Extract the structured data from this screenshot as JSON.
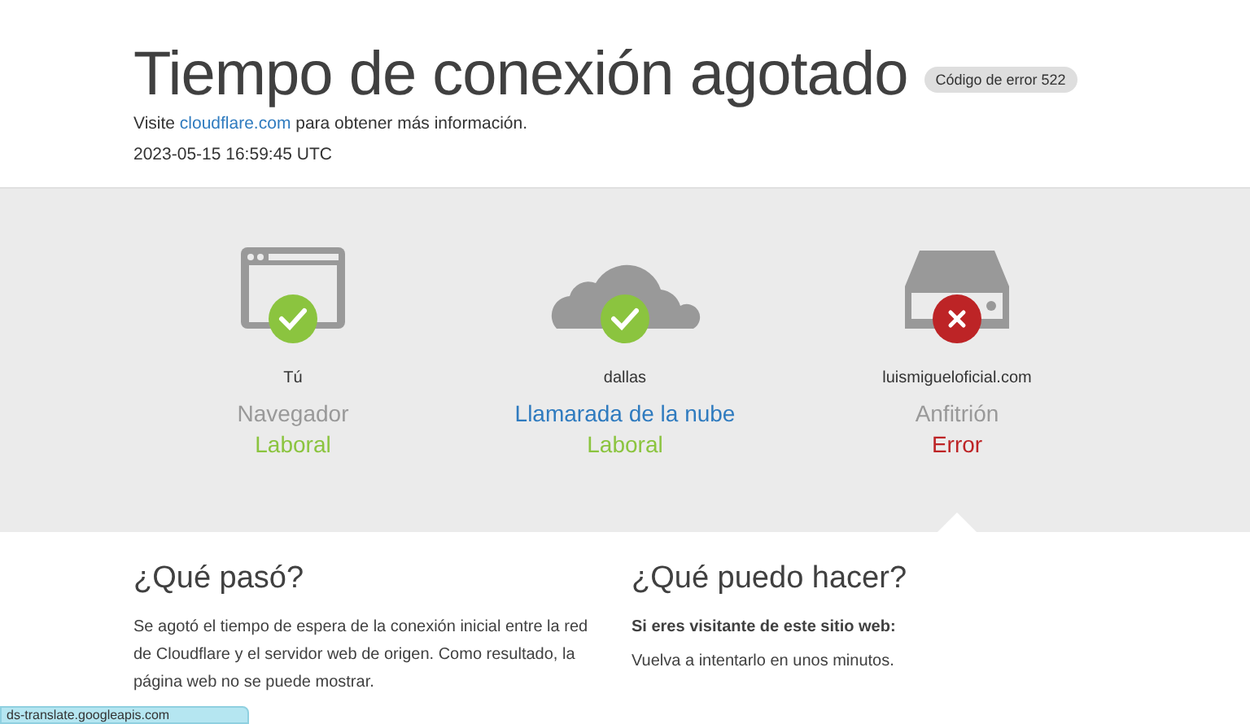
{
  "header": {
    "title": "Tiempo de conexión agotado",
    "error_badge": "Código de error 522",
    "visit_before": "Visite ",
    "visit_link": "cloudflare.com",
    "visit_after": " para obtener más información.",
    "timestamp": "2023-05-15 16:59:45 UTC"
  },
  "nodes": [
    {
      "kind": "browser",
      "location": "Tú",
      "name": "Navegador",
      "name_link": false,
      "status": "Laboral",
      "ok": true,
      "selected": false
    },
    {
      "kind": "cloud",
      "location": "dallas",
      "name": "Llamarada de la nube",
      "name_link": true,
      "status": "Laboral",
      "ok": true,
      "selected": false
    },
    {
      "kind": "server",
      "location": "luismigueloficial.com",
      "name": "Anfitrión",
      "name_link": false,
      "status": "Error",
      "ok": false,
      "selected": true
    }
  ],
  "sections": [
    {
      "heading": "¿Qué pasó?",
      "paragraphs": [
        {
          "bold": false,
          "text": "Se agotó el tiempo de espera de la conexión inicial entre la red de Cloudflare y el servidor web de origen. Como resultado, la página web no se puede mostrar."
        }
      ]
    },
    {
      "heading": "¿Qué puedo hacer?",
      "paragraphs": [
        {
          "bold": true,
          "text": "Si eres visitante de este sitio web:"
        },
        {
          "bold": false,
          "text": "Vuelva a intentarlo en unos minutos."
        }
      ]
    }
  ],
  "status_bar": {
    "text": "ds-translate.googleapis.com"
  }
}
